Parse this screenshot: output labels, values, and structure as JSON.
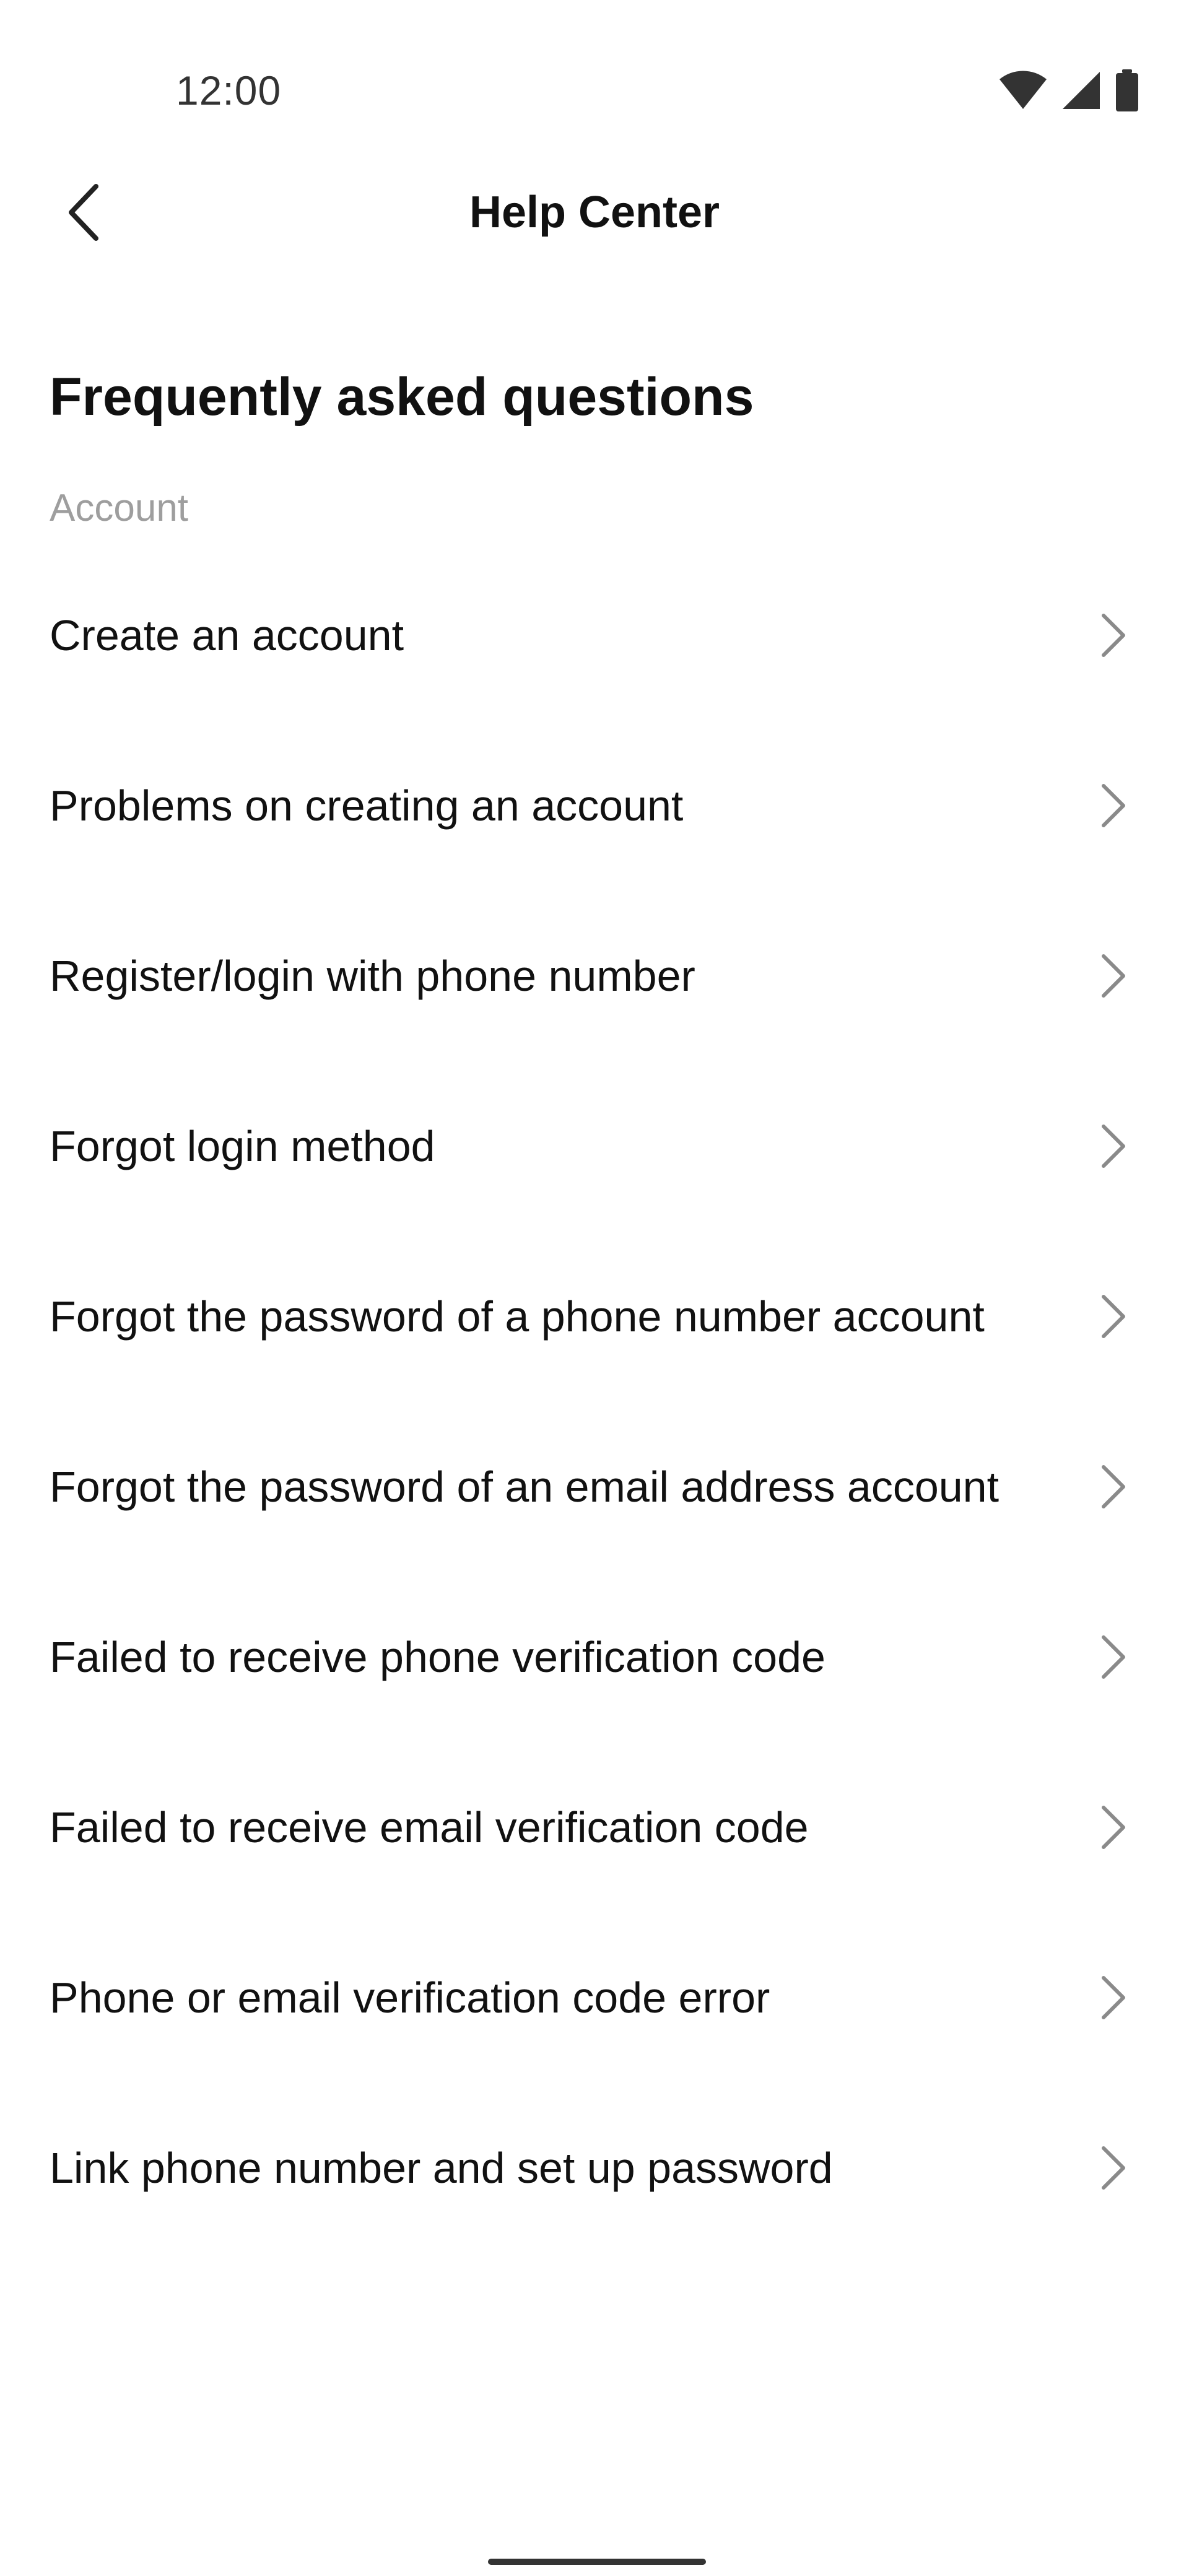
{
  "status_bar": {
    "time": "12:00",
    "icons": [
      "wifi-icon",
      "cellular-signal-icon",
      "battery-icon"
    ]
  },
  "app_bar": {
    "back_icon": "back-arrow-icon",
    "title": "Help Center"
  },
  "content": {
    "heading": "Frequently asked questions",
    "section_label": "Account",
    "items": [
      {
        "label": "Create an account"
      },
      {
        "label": "Problems on creating an account"
      },
      {
        "label": "Register/login with phone number"
      },
      {
        "label": "Forgot login method"
      },
      {
        "label": "Forgot the password of a phone number account"
      },
      {
        "label": "Forgot the password of an email address account"
      },
      {
        "label": "Failed to receive phone verification code"
      },
      {
        "label": "Failed to receive email verification code"
      },
      {
        "label": "Phone or email verification code error"
      },
      {
        "label": "Link phone number and set up password"
      }
    ],
    "item_icon": "chevron-right-icon"
  },
  "colors": {
    "background": "#ffffff",
    "text_primary": "#111111",
    "text_secondary": "#9e9e9e",
    "chevron": "#8a8a8a"
  }
}
